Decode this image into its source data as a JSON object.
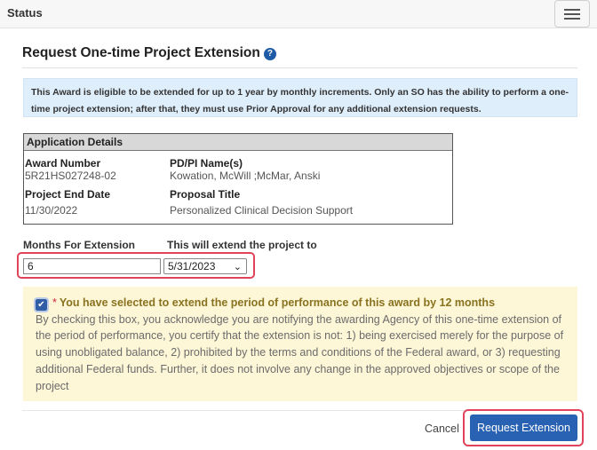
{
  "topbar": {
    "title": "Status",
    "menu_icon": "hamburger-menu-icon"
  },
  "modal": {
    "title": "Request One-time Project Extension",
    "help_icon": "question-circle-icon",
    "help_glyph": "?",
    "info": "This Award is eligible to be extended for up to 1 year by monthly increments. Only an SO has the ability to perform a one-time project extension; after that, they must use Prior Approval for any additional extension requests."
  },
  "application": {
    "heading": "Application Details",
    "award_number_label": "Award Number",
    "award_number": "5R21HS027248-02",
    "pi_label": "PD/PI Name(s)",
    "pi_names": "Kowation, McWill ;McMar, Anski",
    "end_date_label": "Project End Date",
    "end_date": "11/30/2022",
    "proposal_label": "Proposal Title",
    "proposal_title": "Personalized Clinical Decision Support"
  },
  "extension": {
    "months_label": "Months For Extension",
    "extend_label": "This will extend the project to",
    "months_value": "6",
    "extend_to_value": "5/31/2023"
  },
  "acknowledgement": {
    "checked": true,
    "check_glyph": "✔",
    "required_marker": "*",
    "heading": "You have selected to extend the period of performance of this award by 12 months",
    "body": "By checking this box, you acknowledge you are notifying the awarding Agency of this one-time extension of the period of performance, you certify that the extension is not: 1) being exercised merely for the purpose of using unobligated balance, 2) prohibited by the terms and conditions of the Federal award, or 3) requesting additional Federal funds. Further, it does not involve any change in the approved objectives or scope of the project"
  },
  "footer": {
    "cancel_label": "Cancel",
    "submit_label": "Request Extension"
  },
  "colors": {
    "primary": "#2a62b3",
    "highlight": "#e0435a",
    "info_bg": "#dfeefb",
    "warn_bg": "#fdf6d7"
  }
}
